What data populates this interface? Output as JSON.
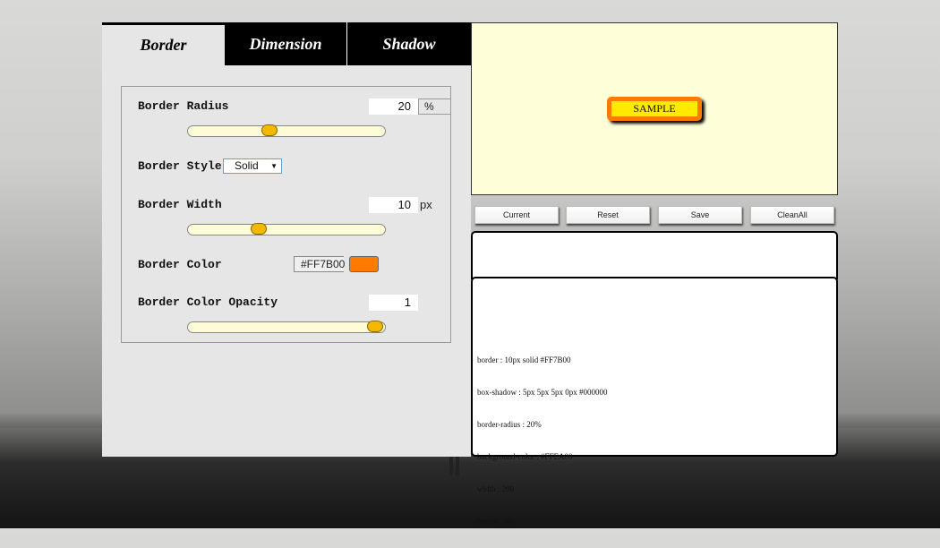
{
  "tabs": [
    {
      "label": "Border",
      "active": true
    },
    {
      "label": "Dimension",
      "active": false
    },
    {
      "label": "Shadow",
      "active": false
    }
  ],
  "border_settings": {
    "radius": {
      "label": "Border Radius",
      "value": "20",
      "unit": "%",
      "slider_fraction": 0.41
    },
    "style": {
      "label": "Border Style",
      "selected": "Solid"
    },
    "width": {
      "label": "Border Width",
      "value": "10",
      "unit": "px",
      "slider_fraction": 0.35
    },
    "color": {
      "label": "Border Color",
      "hex": "#FF7B00",
      "swatch": "#FF7B00"
    },
    "opacity": {
      "label": "Border Color Opacity",
      "value": "1",
      "slider_fraction": 1.0
    }
  },
  "preview": {
    "sample_text": "SAMPLE",
    "background_color": "#FFEA00",
    "border_color": "#FF7B00"
  },
  "buttons": [
    "Current",
    "Reset",
    "Save",
    "CleanAll"
  ],
  "code_output": [
    "border : 10px solid #FF7B00",
    "box-shadow : 5px 5px 5px 0px #000000",
    "border-radius : 20%",
    "background-color : #FFEA00",
    "width : 200",
    "height : 50"
  ],
  "colors": {
    "slider_track": "#FDFCD7",
    "slider_thumb": "#F5B800",
    "preview_bg": "#FEFED9"
  }
}
